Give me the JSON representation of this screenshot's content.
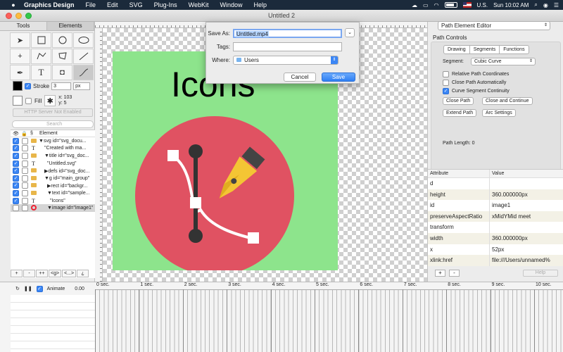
{
  "menubar": {
    "app_name": "Graphics Design",
    "menus": [
      "File",
      "Edit",
      "SVG",
      "Plug-Ins",
      "WebKit",
      "Window",
      "Help"
    ],
    "input_source": "U.S.",
    "clock": "Sun 10:02 AM",
    "battery_level": 0.8
  },
  "window": {
    "title": "Untitled 2"
  },
  "left_panel": {
    "tabs": [
      "Tools",
      "Elements"
    ],
    "stroke_label": "Stroke",
    "stroke_width": "3",
    "stroke_unit": "px",
    "fill_label": "Fill",
    "coord_x": "x: 103",
    "coord_y": "y: 5",
    "server_button": "HTTP Server Not Enabled",
    "search_placeholder": "Search",
    "tree_header": {
      "visible": "👁",
      "lock": "🔒",
      "section": "§",
      "element": "Element"
    },
    "tree_rows": [
      {
        "label": "▼svg id=\"svg_docu...",
        "kind": "folder"
      },
      {
        "label": "\"Created with ma...",
        "kind": "text"
      },
      {
        "label": "▼title id=\"svg_doc...",
        "kind": "folder"
      },
      {
        "label": "\"Untitled.svg\"",
        "kind": "text"
      },
      {
        "label": "▶defs id=\"svg_doc...",
        "kind": "folder"
      },
      {
        "label": "▼g id=\"main_group\"",
        "kind": "folder"
      },
      {
        "label": "▶rect id=\"backgr...",
        "kind": "folder"
      },
      {
        "label": "▼text id=\"sample...",
        "kind": "folder"
      },
      {
        "label": "\"Icons\"",
        "kind": "text"
      },
      {
        "label": "▼image id=\"image1\"",
        "kind": "target"
      }
    ],
    "bottom_buttons": [
      "+",
      "-",
      "++",
      "<g>",
      "<...>",
      "¿"
    ]
  },
  "canvas": {
    "text": "Icons",
    "artboard_color": "#8de48c",
    "circle_color": "#e05262",
    "pen_color": "#f4c534"
  },
  "save_dialog": {
    "save_as_label": "Save As:",
    "save_as_value": "Untitled.mp4",
    "tags_label": "Tags:",
    "tags_value": "",
    "where_label": "Where:",
    "where_value": "Users",
    "cancel_label": "Cancel",
    "save_label": "Save"
  },
  "right_panel": {
    "editor_select": "Path Element Editor",
    "section_title": "Path Controls",
    "tabs": [
      "Drawing",
      "Segments",
      "Functions"
    ],
    "segment_label": "Segment:",
    "segment_value": "Cubic Curve",
    "options": [
      {
        "label": "Relative Path Coordinates",
        "checked": false
      },
      {
        "label": "Close Path Automatically",
        "checked": false
      },
      {
        "label": "Curve Segment Continuity",
        "checked": true
      }
    ],
    "buttons": [
      "Close Path",
      "Close and Continue",
      "Extend Path",
      "Arc Settings"
    ],
    "path_length": "Path Length:  0",
    "attr_headers": [
      "Attribute",
      "Value"
    ],
    "attributes": [
      {
        "name": "d",
        "value": ""
      },
      {
        "name": "height",
        "value": "360.000000px"
      },
      {
        "name": "id",
        "value": "image1"
      },
      {
        "name": "preserveAspectRatio",
        "value": "xMidYMid meet"
      },
      {
        "name": "transform",
        "value": ""
      },
      {
        "name": "width",
        "value": "360.000000px"
      },
      {
        "name": "x",
        "value": "52px"
      },
      {
        "name": "xlink:href",
        "value": "file:///Users/unnamed%"
      }
    ],
    "add_label": "+",
    "remove_label": "-",
    "help_label": "Help"
  },
  "timeline": {
    "animate_label": "Animate",
    "time_value": "0.00",
    "seconds": [
      "0 sec.",
      "1 sec.",
      "2 sec.",
      "3 sec.",
      "4 sec.",
      "5 sec.",
      "6 sec.",
      "7 sec.",
      "8 sec.",
      "9 sec.",
      "10 sec."
    ]
  }
}
